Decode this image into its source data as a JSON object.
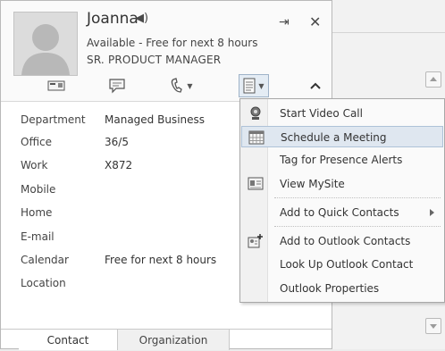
{
  "contact": {
    "name": "Joanna",
    "status": "Available - Free for next 8 hours",
    "title": "SR. PRODUCT MANAGER"
  },
  "icons": {
    "speaker": "speaker-icon",
    "pin": "pin-icon",
    "close": "close-icon",
    "email": "email-icon",
    "im": "instant-message-icon",
    "call": "phone-icon",
    "more": "more-options-icon",
    "collapse": "chevron-up-icon"
  },
  "fields": [
    {
      "label": "Department",
      "value": "Managed Business"
    },
    {
      "label": "Office",
      "value": "36/5"
    },
    {
      "label": "Work",
      "value": "X872"
    },
    {
      "label": "Mobile",
      "value": ""
    },
    {
      "label": "Home",
      "value": ""
    },
    {
      "label": "E-mail",
      "value": ""
    },
    {
      "label": "Calendar",
      "value": "Free for next 8 hours"
    },
    {
      "label": "Location",
      "value": ""
    }
  ],
  "tabs": {
    "contact": "Contact",
    "organization": "Organization"
  },
  "menu": {
    "items": [
      {
        "label": "Start Video Call",
        "icon": "video-call-icon"
      },
      {
        "label": "Schedule a Meeting",
        "icon": "calendar-icon",
        "highlighted": true
      },
      {
        "label": "Tag for Presence Alerts",
        "icon": ""
      },
      {
        "label": "View MySite",
        "icon": "mysite-icon"
      },
      {
        "label": "Add to Quick Contacts",
        "icon": "",
        "submenu": true
      },
      {
        "label": "Add to Outlook Contacts",
        "icon": "add-contact-icon"
      },
      {
        "label": "Look Up Outlook Contact",
        "icon": ""
      },
      {
        "label": "Outlook Properties",
        "icon": ""
      }
    ]
  },
  "colors": {
    "highlight": "#dfe7f0",
    "highlight_border": "#aec2d8",
    "menu_bg": "#fafafa"
  }
}
